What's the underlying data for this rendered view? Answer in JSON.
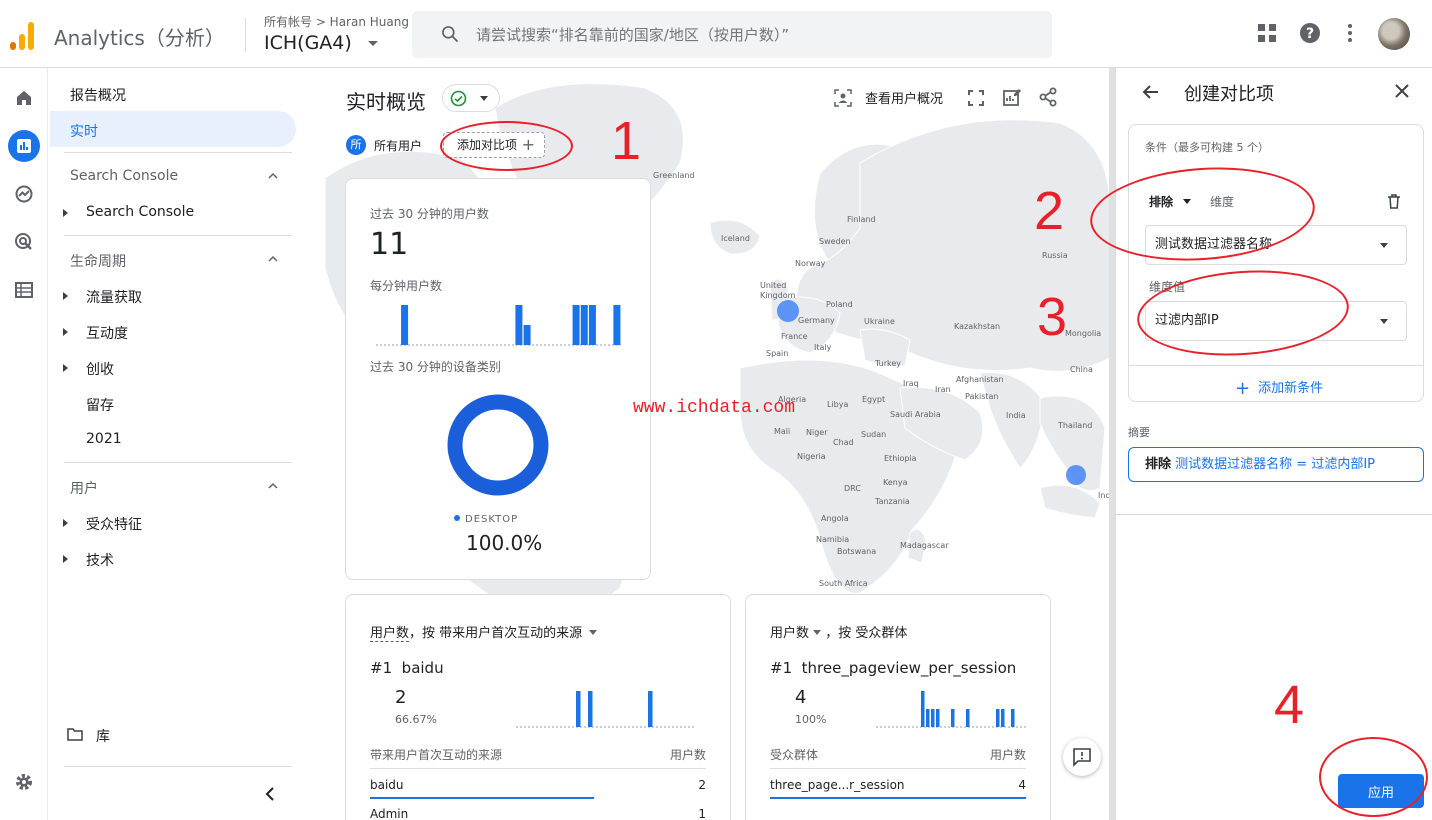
{
  "header": {
    "app_name": "Analytics（分析）",
    "account_crumb": "所有帐号 > Haran Huang",
    "property": "ICH(GA4)",
    "search_placeholder": "请尝试搜索“排名靠前的国家/地区（按用户数）”"
  },
  "colors": {
    "accent": "#1a73e8",
    "annotation": "#e8202a",
    "success": "#1e8e3e"
  },
  "nav": {
    "overview": "报告概况",
    "realtime": "实时",
    "sc_section": "Search Console",
    "sc_item": "Search Console",
    "lifecycle_section": "生命周期",
    "lifecycle_items": [
      "流量获取",
      "互动度",
      "创收",
      "留存",
      "2021"
    ],
    "user_section": "用户",
    "user_items": [
      "受众特征",
      "技术"
    ],
    "library": "库"
  },
  "main": {
    "title": "实时概览",
    "chip_avatar": "所",
    "chip_label": "所有用户",
    "add_compare": "添加对比项",
    "view_user_overview": "查看用户概况",
    "watermark": "www.ichdata.com"
  },
  "map_labels": {
    "greenland": "Greenland",
    "iceland": "Iceland",
    "finland": "Finland",
    "sweden": "Sweden",
    "norway": "Norway",
    "russia": "Russia",
    "uk": "United Kingdom",
    "poland": "Poland",
    "germany": "Germany",
    "ukraine": "Ukraine",
    "kazakhstan": "Kazakhstan",
    "france": "France",
    "italy": "Italy",
    "mongolia": "Mongolia",
    "spain": "Spain",
    "turkey": "Turkey",
    "china": "China",
    "iraq": "Iraq",
    "iran": "Iran",
    "afghanistan": "Afghanistan",
    "algeria": "Algeria",
    "libya": "Libya",
    "egypt": "Egypt",
    "pakistan": "Pakistan",
    "saudi": "Saudi Arabia",
    "india": "India",
    "mali": "Mali",
    "niger": "Niger",
    "chad": "Chad",
    "sudan": "Sudan",
    "thailand": "Thailand",
    "nigeria": "Nigeria",
    "ethiopia": "Ethiopia",
    "drc": "DRC",
    "kenya": "Kenya",
    "tanzania": "Tanzania",
    "angola": "Angola",
    "namibia": "Namibia",
    "botswana": "Botswana",
    "madagascar": "Madagascar",
    "south_africa": "South Africa",
    "indo": "Inc"
  },
  "users_card": {
    "title": "过去 30 分钟的用户数",
    "value": "11",
    "per_minute": "每分钟用户数",
    "device_title": "过去 30 分钟的设备类别",
    "device_label": "DESKTOP",
    "device_value": "100.0%",
    "minute_bars": [
      0,
      0,
      0,
      2,
      0,
      0,
      0,
      0,
      0,
      0,
      0,
      0,
      0,
      0,
      0,
      0,
      0,
      2,
      1,
      0,
      0,
      0,
      0,
      0,
      2,
      2,
      2,
      0,
      0,
      2
    ]
  },
  "source_card": {
    "metric": "用户数",
    "by": "，按 带来用户首次互动的来源",
    "top_rank": "#1",
    "top_name": "baidu",
    "top_value": "2",
    "top_pct": "66.67%",
    "col_dim": "带来用户首次互动的来源",
    "col_metric": "用户数",
    "rows": [
      {
        "name": "baidu",
        "value": "2"
      },
      {
        "name": "Admin",
        "value": "1"
      }
    ]
  },
  "audience_card": {
    "metric": "用户数",
    "by": "，按 受众群体",
    "top_rank": "#1",
    "top_name": "three_pageview_per_session",
    "top_value": "4",
    "top_pct": "100%",
    "col_dim": "受众群体",
    "col_metric": "用户数",
    "rows": [
      {
        "name": "three_page...r_session",
        "value": "4"
      }
    ]
  },
  "panel": {
    "title": "创建对比项",
    "conditions_hint": "条件（最多可构建 5 个）",
    "mode": "排除",
    "dimension_label": "维度",
    "dimension_value": "测试数据过滤器名称",
    "value_label": "维度值",
    "value_value": "过滤内部IP",
    "add_condition": "添加新条件",
    "summary_label": "摘要",
    "summary_mode": "排除",
    "summary_expr": "测试数据过滤器名称 = 过滤内部IP",
    "apply": "应用"
  },
  "annotations": [
    "1",
    "2",
    "3",
    "4"
  ]
}
